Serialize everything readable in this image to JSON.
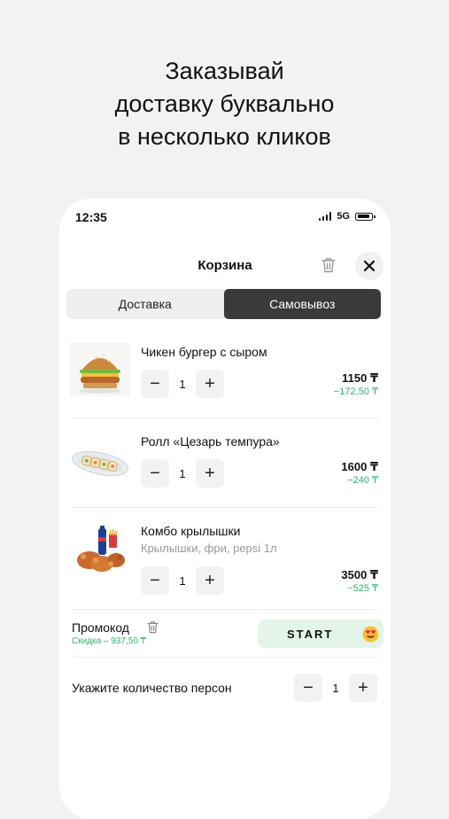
{
  "headline": {
    "line1": "Заказывай",
    "line2": "доставку буквально",
    "line3": "в несколько кликов"
  },
  "status_bar": {
    "time": "12:35",
    "network": "5G"
  },
  "header": {
    "title": "Корзина"
  },
  "tabs": [
    {
      "label": "Доставка",
      "active": false
    },
    {
      "label": "Самовывоз",
      "active": true
    }
  ],
  "items": [
    {
      "name": "Чикен бургер с сыром",
      "description": "",
      "quantity": "1",
      "price": "1150 ₸",
      "discount": "−172,50 ₸"
    },
    {
      "name": "Ролл «Цезарь темпура»",
      "description": "",
      "quantity": "1",
      "price": "1600 ₸",
      "discount": "−240 ₸"
    },
    {
      "name": "Комбо крылышки",
      "description": "Крылышки, фри, pepsi 1л",
      "quantity": "1",
      "price": "3500 ₸",
      "discount": "−525 ₸"
    }
  ],
  "stepper": {
    "minus": "−",
    "plus": "+"
  },
  "promo": {
    "label": "Промокод",
    "discount_text": "Скидка – 937,50 ₸",
    "code": "START"
  },
  "persons": {
    "label": "Укажите количество персон",
    "quantity": "1"
  },
  "colors": {
    "accent_green": "#2fb36a",
    "promo_bg": "#e3f5e8",
    "active_tab": "#3a3a3a"
  }
}
